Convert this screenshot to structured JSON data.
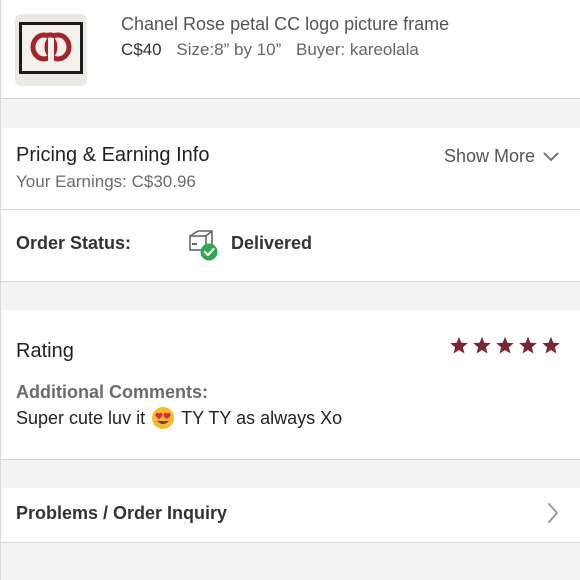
{
  "product": {
    "title": "Chanel Rose petal CC logo picture frame",
    "price": "C$40",
    "size": "Size:8” by 10”",
    "buyer": "Buyer: kareolala",
    "thumbnail_icon": "framed-cc-logo-image"
  },
  "pricing": {
    "title": "Pricing & Earning Info",
    "earnings": "Your Earnings: C$30.96",
    "show_more": "Show More"
  },
  "order_status": {
    "label": "Order Status:",
    "value": "Delivered",
    "icon": "package-delivered-icon"
  },
  "rating": {
    "title": "Rating",
    "stars": 5,
    "star_color": "#7a2531",
    "comments_label": "Additional Comments:",
    "comment_before": "Super cute luv it",
    "comment_after": "TY TY as always Xo"
  },
  "problems": {
    "label": "Problems / Order Inquiry"
  },
  "colors": {
    "background": "#ffffff",
    "section_gap": "#f3f3f3",
    "divider": "#d6d6d6",
    "check_green": "#2fa84f"
  }
}
